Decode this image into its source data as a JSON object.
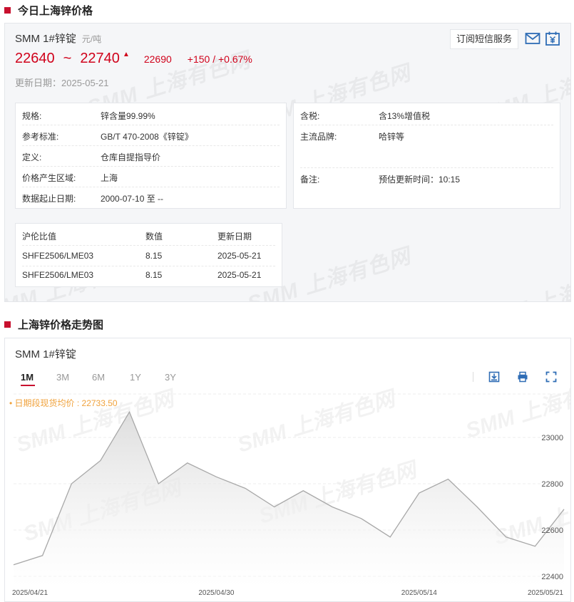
{
  "section1": {
    "title": "今日上海锌价格"
  },
  "product": {
    "name": "SMM 1#锌锭",
    "unit": "元/吨",
    "price_low": "22640",
    "tilde": "~",
    "price_high": "22740",
    "avg": "22690",
    "change": "+150",
    "change_sep": "/",
    "change_pct": "+0.67%",
    "update_date": "更新日期：2025-05-21",
    "trend_icon": "up-arrow-icon"
  },
  "subscribe": {
    "label": "订阅短信服务",
    "mail_icon": "mail-icon",
    "calendar_icon": "calendar-yen-icon"
  },
  "watermark": "SMM 上海有色网",
  "specs_left": [
    {
      "key": "规格:",
      "value": "锌含量99.99%"
    },
    {
      "key": "参考标准:",
      "value": "GB/T 470-2008《锌锭》"
    },
    {
      "key": "定义:",
      "value": "仓库自提指导价"
    },
    {
      "key": "价格产生区域:",
      "value": "上海"
    },
    {
      "key": "数据起止日期:",
      "value": "2000-07-10 至 --"
    }
  ],
  "specs_right": [
    {
      "key": "含税:",
      "value": "含13%增值税"
    },
    {
      "key": "主流品牌:",
      "value": "哈锌等"
    },
    {
      "key": "备注:",
      "value": "预估更新时间：10:15"
    }
  ],
  "ratio_table": {
    "headers": [
      "沪伦比值",
      "数值",
      "更新日期"
    ],
    "rows": [
      [
        "SHFE2506/LME03",
        "8.15",
        "2025-05-21"
      ],
      [
        "SHFE2506/LME03",
        "8.15",
        "2025-05-21"
      ]
    ]
  },
  "section2": {
    "title": "上海锌价格走势图"
  },
  "chart_panel": {
    "product": "SMM 1#锌锭",
    "tabs": [
      "1M",
      "3M",
      "6M",
      "1Y",
      "3Y"
    ],
    "active_tab": "1M",
    "icons": [
      "download-icon",
      "print-icon",
      "fullscreen-icon"
    ],
    "avg_note": "• 日期段现货均价 : 22733.50"
  },
  "chart_data": {
    "type": "area",
    "title": "",
    "xlabel": "",
    "ylabel": "",
    "x": [
      "2025-04-21",
      "2025-04-22",
      "2025-04-23",
      "2025-04-24",
      "2025-04-25",
      "2025-04-28",
      "2025-04-29",
      "2025-04-30",
      "2025-05-06",
      "2025-05-07",
      "2025-05-08",
      "2025-05-09",
      "2025-05-12",
      "2025-05-13",
      "2025-05-14",
      "2025-05-15",
      "2025-05-16",
      "2025-05-19",
      "2025-05-20",
      "2025-05-21"
    ],
    "series": [
      {
        "values": [
          22450,
          22490,
          22800,
          22900,
          23110,
          22800,
          22890,
          22830,
          22780,
          22700,
          22770,
          22700,
          22650,
          22570,
          22760,
          22820,
          22700,
          22570,
          22530,
          22690
        ]
      }
    ],
    "xticks": [
      "2025/04/21",
      "2025/04/30",
      "2025/05/14",
      "2025/05/21"
    ],
    "yticks": [
      22400,
      22600,
      22800,
      23000
    ],
    "ylim": [
      22400,
      23100
    ],
    "grid": true,
    "line_color": "#a8a8a8",
    "accent_red": "#c8102e",
    "price_red": "#d0021b",
    "avg_color": "#f0a23c"
  }
}
